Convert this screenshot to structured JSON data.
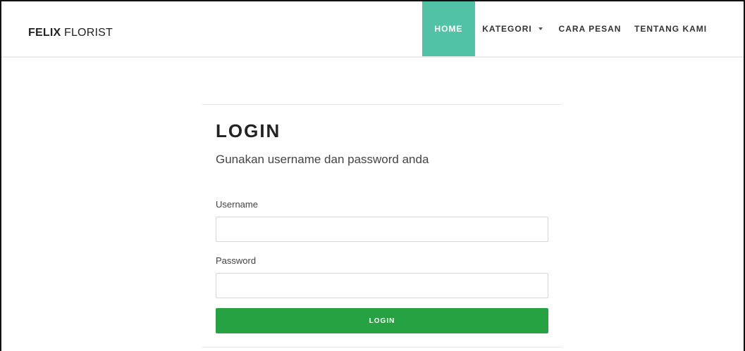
{
  "navbar": {
    "brand_bold": "FELIX",
    "brand_rest": " FLORIST",
    "items": [
      {
        "label": "HOME",
        "active": true
      },
      {
        "label": "KATEGORI",
        "has_dropdown": true
      },
      {
        "label": "CARA PESAN"
      },
      {
        "label": "TENTANG KAMI"
      }
    ]
  },
  "login": {
    "title": "LOGIN",
    "subtitle": "Gunakan username dan password anda",
    "username_label": "Username",
    "username_value": "",
    "password_label": "Password",
    "password_value": "",
    "button_label": "LOGIN"
  },
  "colors": {
    "accent": "#52c2a7",
    "button": "#27a243"
  }
}
